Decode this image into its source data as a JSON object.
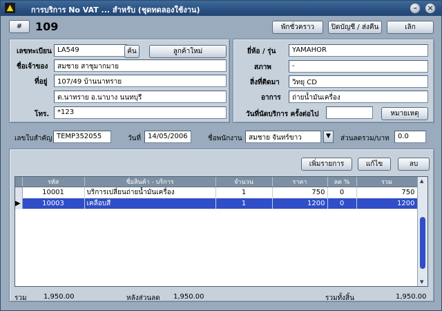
{
  "window": {
    "title": "การบริการ No VAT ... สำหรับ (ชุดทดลองใช้งาน)",
    "min_icon": "minimize-icon",
    "close_icon": "close-icon"
  },
  "toolbar": {
    "hash_label": "#",
    "job_number": "109",
    "pause_label": "พักชั่วคราว",
    "close_account_label": "ปิดบัญชี / ส่งคืน",
    "cancel_label": "เลิก"
  },
  "customer": {
    "plate_label": "เลขทะเบียน",
    "plate_value": "LA549",
    "find_label": "ค้น",
    "new_customer_label": "ลูกค้าใหม่",
    "owner_label": "ชื่อเจ้าของ",
    "owner_value": "สมชาย สาชุมากมาย",
    "address_label": "ที่อยู่",
    "address_line1": "107/49 บ้านนาทราย",
    "address_line2": "ต.นาทราย  อ.นาบาง นนทบุรี",
    "phone_label": "โทร.",
    "phone_value": "*123"
  },
  "vehicle": {
    "brand_label": "ยี่ห้อ / รุ่น",
    "brand_value": "YAMAHOR",
    "condition_label": "สภาพ",
    "condition_value": "-",
    "accessories_label": "สิ่งที่ติดมา",
    "accessories_value": "วิทยุ CD",
    "symptom_label": "อาการ",
    "symptom_value": "ถ่ายน้ำมันเครื่อง",
    "next_service_label": "วันที่นัดบริการ ครั้งต่อไป",
    "next_service_value": "",
    "note_label": "หมายเหตุ"
  },
  "document": {
    "doc_no_label": "เลขใบสำคัญ",
    "doc_no_value": "TEMP352055",
    "date_label": "วันที่",
    "date_value": "14/05/2006",
    "employee_label": "ชื่อพนักงาน",
    "employee_value": "สมชาย จันทร์ขาว",
    "discount_label": "ส่วนลดรวม/บาท",
    "discount_value": "0.0"
  },
  "items": {
    "add_label": "เพิ่มรายการ",
    "edit_label": "แก้ไข",
    "delete_label": "ลบ",
    "columns": [
      "รหัส",
      "ชื่อสินค้า - บริการ",
      "จำนวน",
      "ราคา",
      "ลด %",
      "รวม"
    ],
    "rows": [
      {
        "code": "10001",
        "name": "บริการเปลี่ยนถ่ายน้ำมันเครื่อง",
        "qty": "1",
        "price": "750",
        "disc": "0",
        "total": "750"
      },
      {
        "code": "10003",
        "name": "เคลือบสี",
        "qty": "1",
        "price": "1200",
        "disc": "0",
        "total": "1200"
      }
    ]
  },
  "footer": {
    "sum_label": "รวม",
    "sum_value": "1,950.00",
    "after_discount_label": "หลังส่วนลด",
    "after_discount_value": "1,950.00",
    "grand_total_label": "รวมทั้งสิ้น",
    "grand_total_value": "1,950.00"
  },
  "colors": {
    "titlebar": "#2a5080",
    "window_bg": "#9aabbd",
    "panel_bg": "#c6d1dc",
    "selection": "#2f4ec8"
  }
}
